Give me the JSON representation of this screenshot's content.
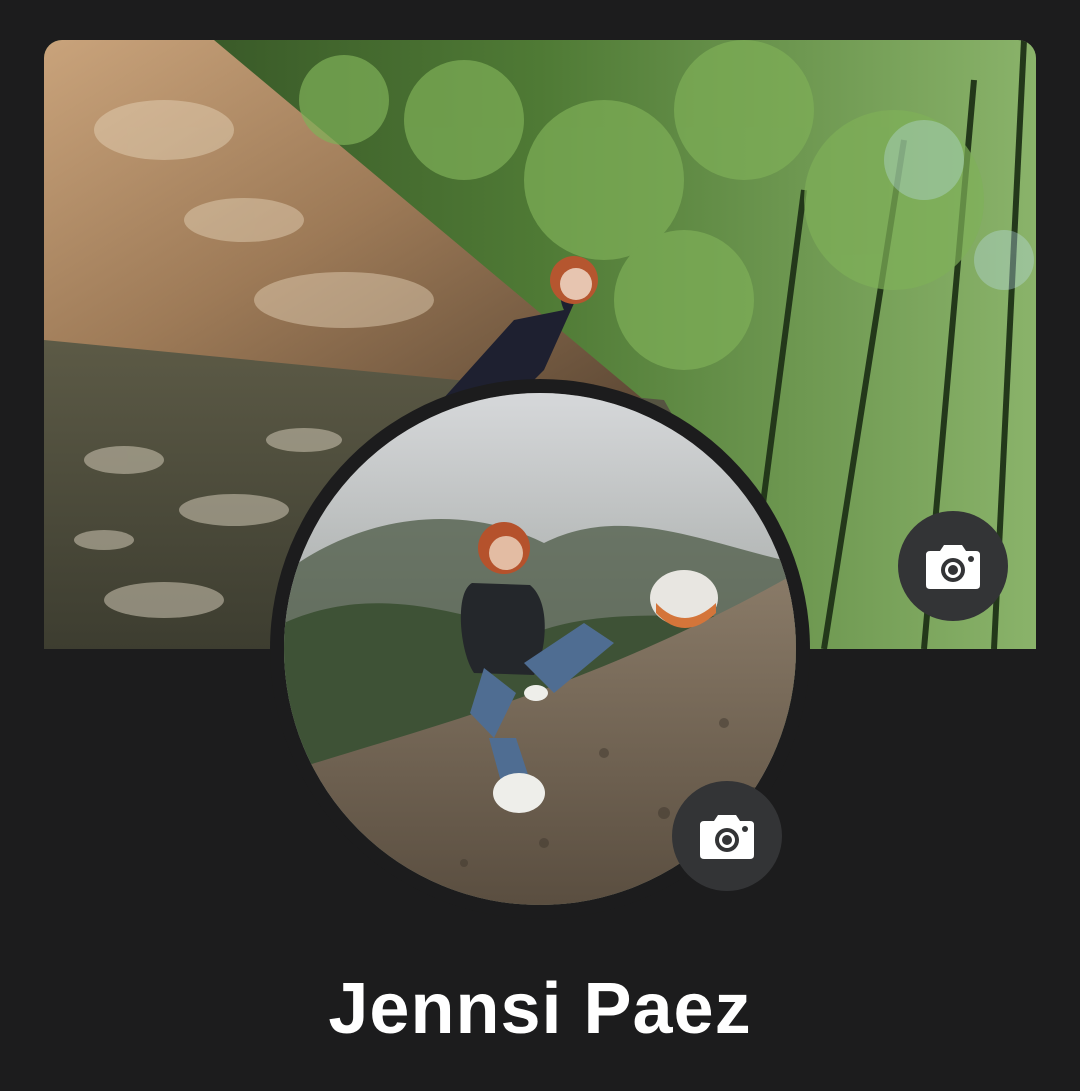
{
  "profile": {
    "name": "Jennsi Paez"
  },
  "icons": {
    "cover_camera": "camera-icon",
    "avatar_camera": "camera-icon"
  },
  "colors": {
    "background": "#1c1c1d",
    "button": "#333436",
    "text": "#ffffff"
  }
}
